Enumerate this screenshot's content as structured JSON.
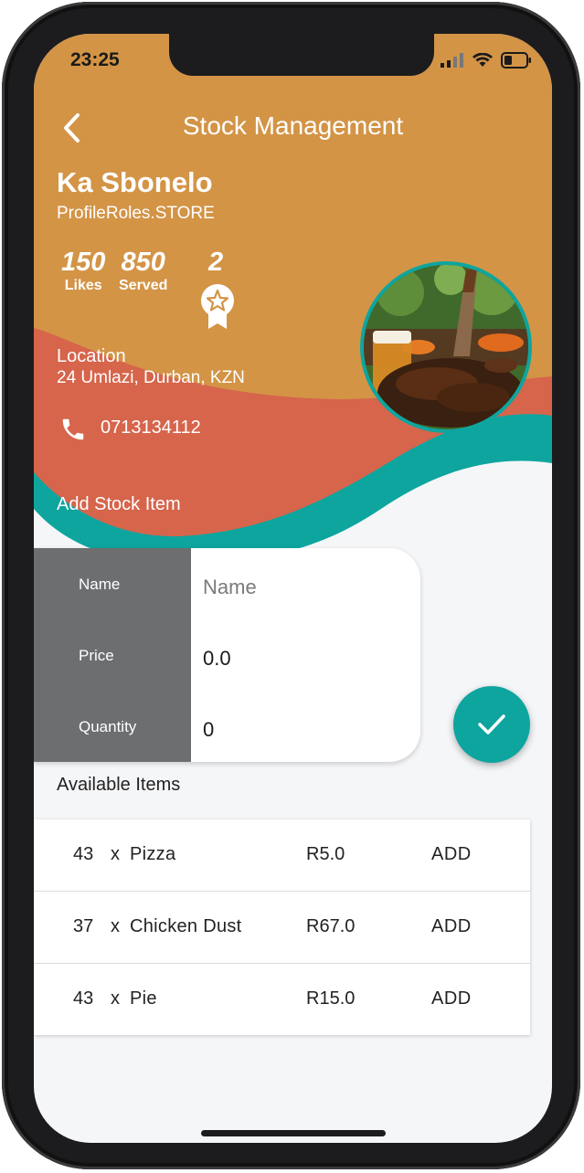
{
  "status_bar": {
    "time": "23:25"
  },
  "header": {
    "title": "Stock Management"
  },
  "store": {
    "name": "Ka Sbonelo",
    "role": "ProfileRoles.STORE",
    "stats": [
      {
        "value": "150",
        "label": "Likes"
      },
      {
        "value": "850",
        "label": "Served"
      },
      {
        "value": "2",
        "icon": "award-badge-icon"
      }
    ],
    "location_label": "Location",
    "location_value": "24 Umlazi, Durban, KZN",
    "phone": "0713134112",
    "avatar_icon": "food-photo-avatar"
  },
  "add_stock": {
    "title": "Add Stock Item",
    "fields": [
      {
        "label": "Name",
        "value": "",
        "placeholder": "Name"
      },
      {
        "label": "Price",
        "value": "0.0"
      },
      {
        "label": "Quantity",
        "value": "0"
      }
    ],
    "submit_icon": "check-icon"
  },
  "available": {
    "title": "Available Items",
    "items": [
      {
        "qty": "43",
        "x": "x",
        "name": "Pizza",
        "price": "R5.0",
        "action": "ADD"
      },
      {
        "qty": "37",
        "x": "x",
        "name": "Chicken Dust",
        "price": "R67.0",
        "action": "ADD"
      },
      {
        "qty": "43",
        "x": "x",
        "name": "Pie",
        "price": "R15.0",
        "action": "ADD"
      }
    ]
  },
  "colors": {
    "orange": "#D39446",
    "coral": "#D6654C",
    "teal": "#0EA59F",
    "gray": "#6D6E70"
  }
}
